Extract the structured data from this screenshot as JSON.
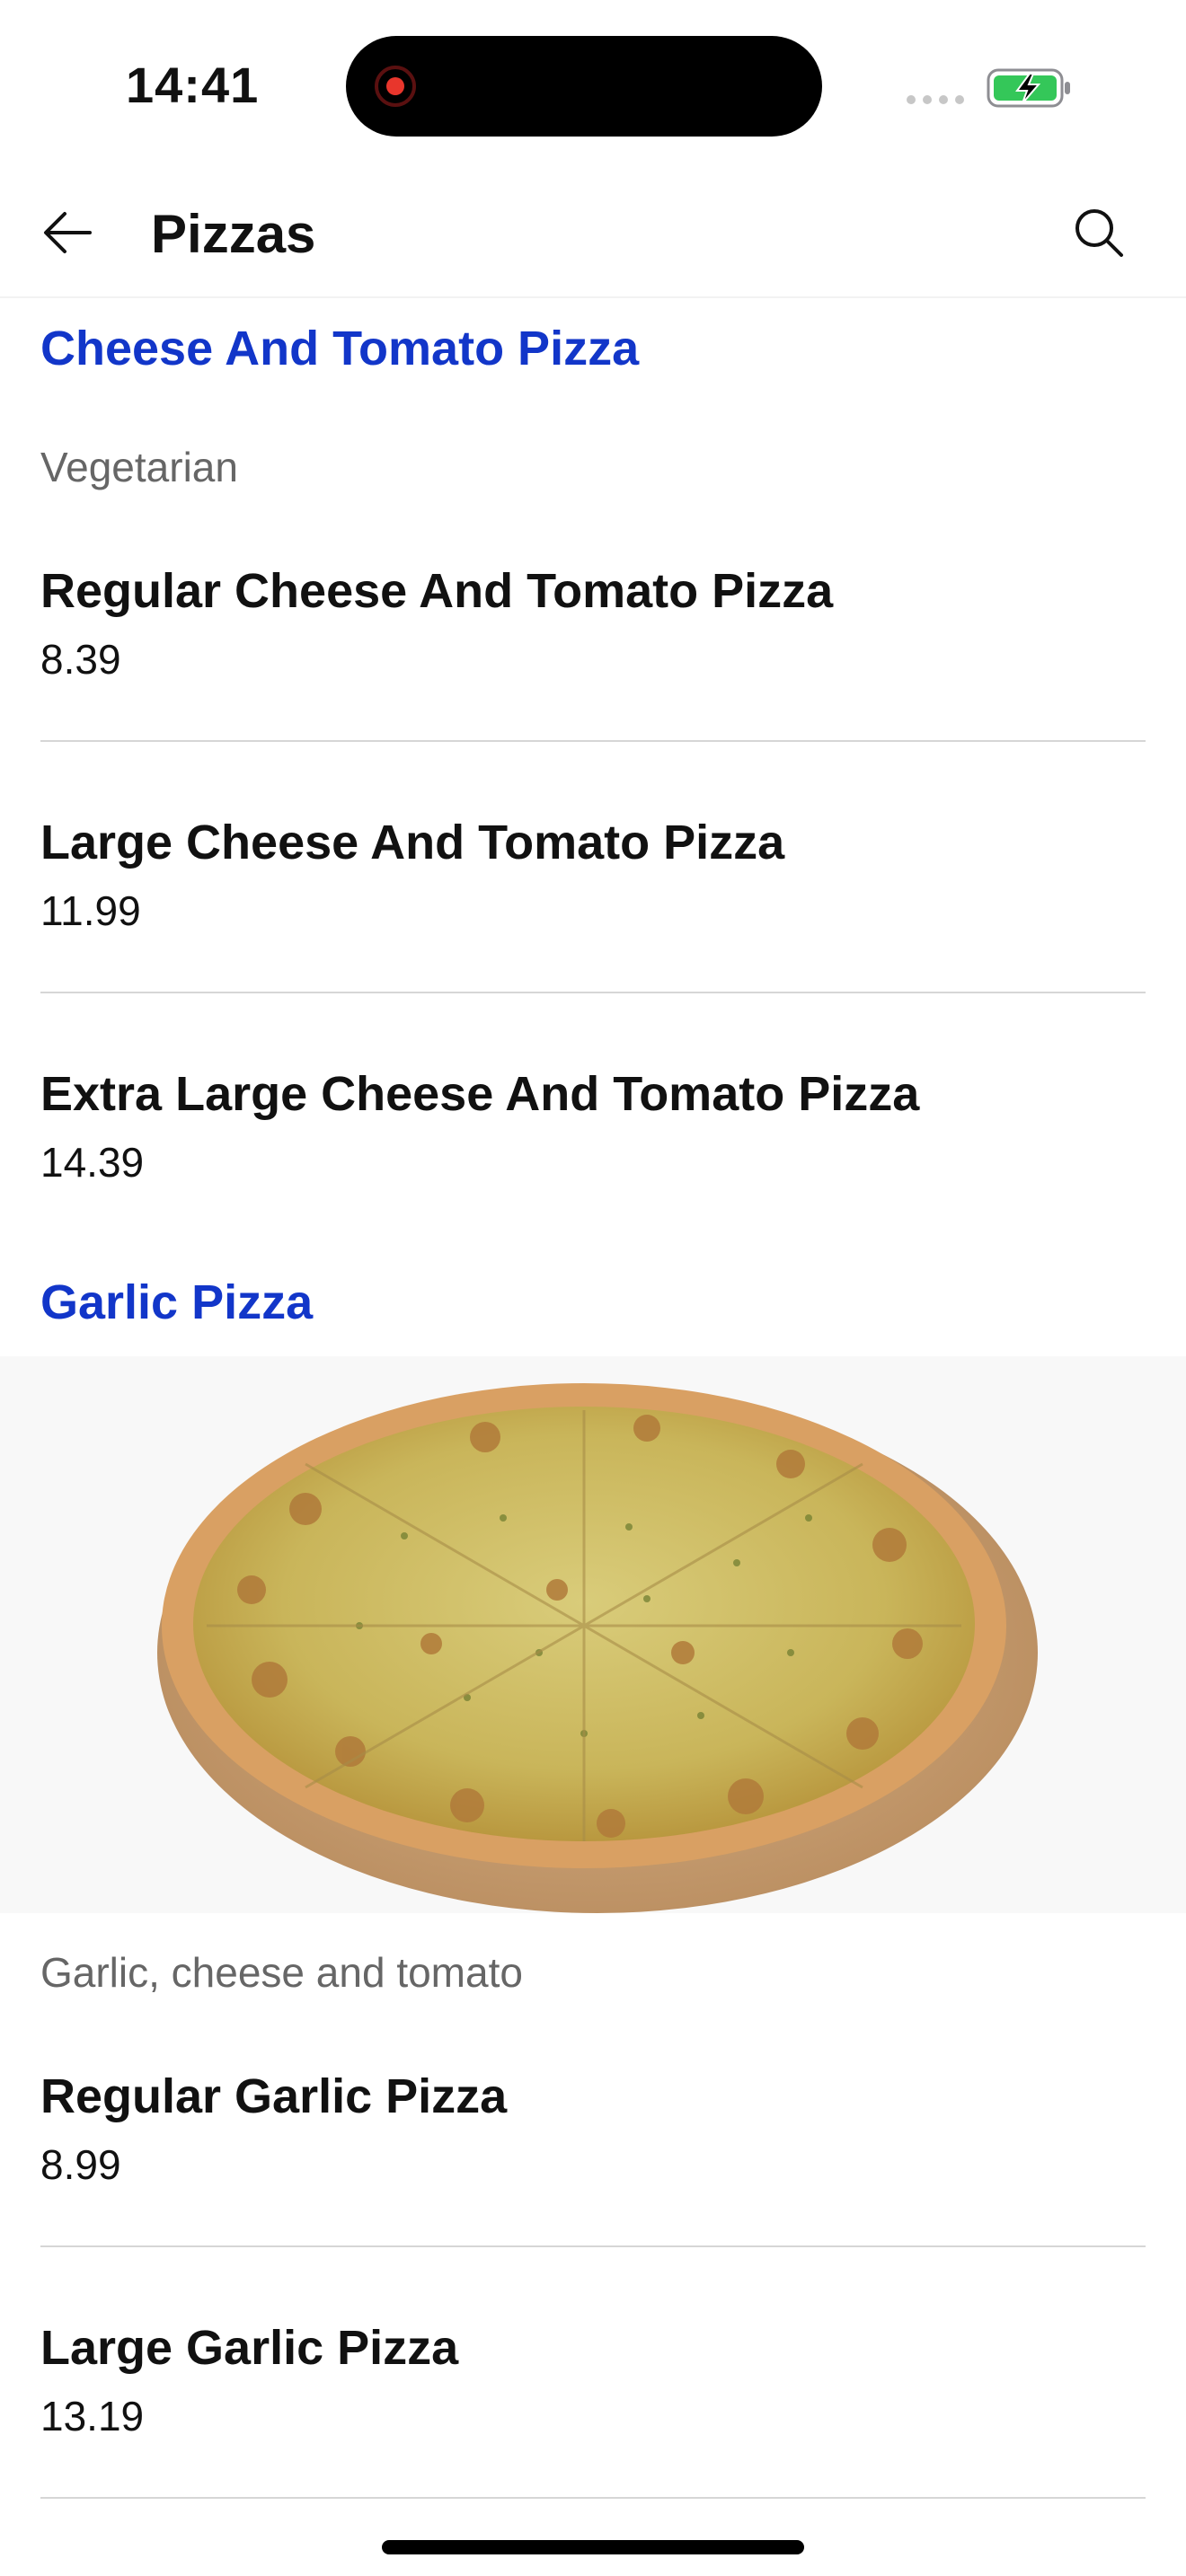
{
  "status_bar": {
    "time": "14:41"
  },
  "header": {
    "title": "Pizzas"
  },
  "sections": [
    {
      "title": "Cheese And Tomato Pizza",
      "description": "Vegetarian",
      "items": [
        {
          "name": "Regular Cheese And Tomato Pizza",
          "price": "8.39"
        },
        {
          "name": "Large Cheese And Tomato Pizza",
          "price": "11.99"
        },
        {
          "name": "Extra Large Cheese And Tomato Pizza",
          "price": "14.39"
        }
      ]
    },
    {
      "title": "Garlic Pizza",
      "description": "Garlic, cheese and tomato",
      "image": "garlic-pizza-photo",
      "items": [
        {
          "name": "Regular Garlic Pizza",
          "price": "8.99"
        },
        {
          "name": "Large Garlic Pizza",
          "price": "13.19"
        }
      ]
    }
  ],
  "colors": {
    "section_title": "#1236c9",
    "description": "#666666",
    "divider": "#d6d6d6",
    "battery": "#34c759"
  }
}
